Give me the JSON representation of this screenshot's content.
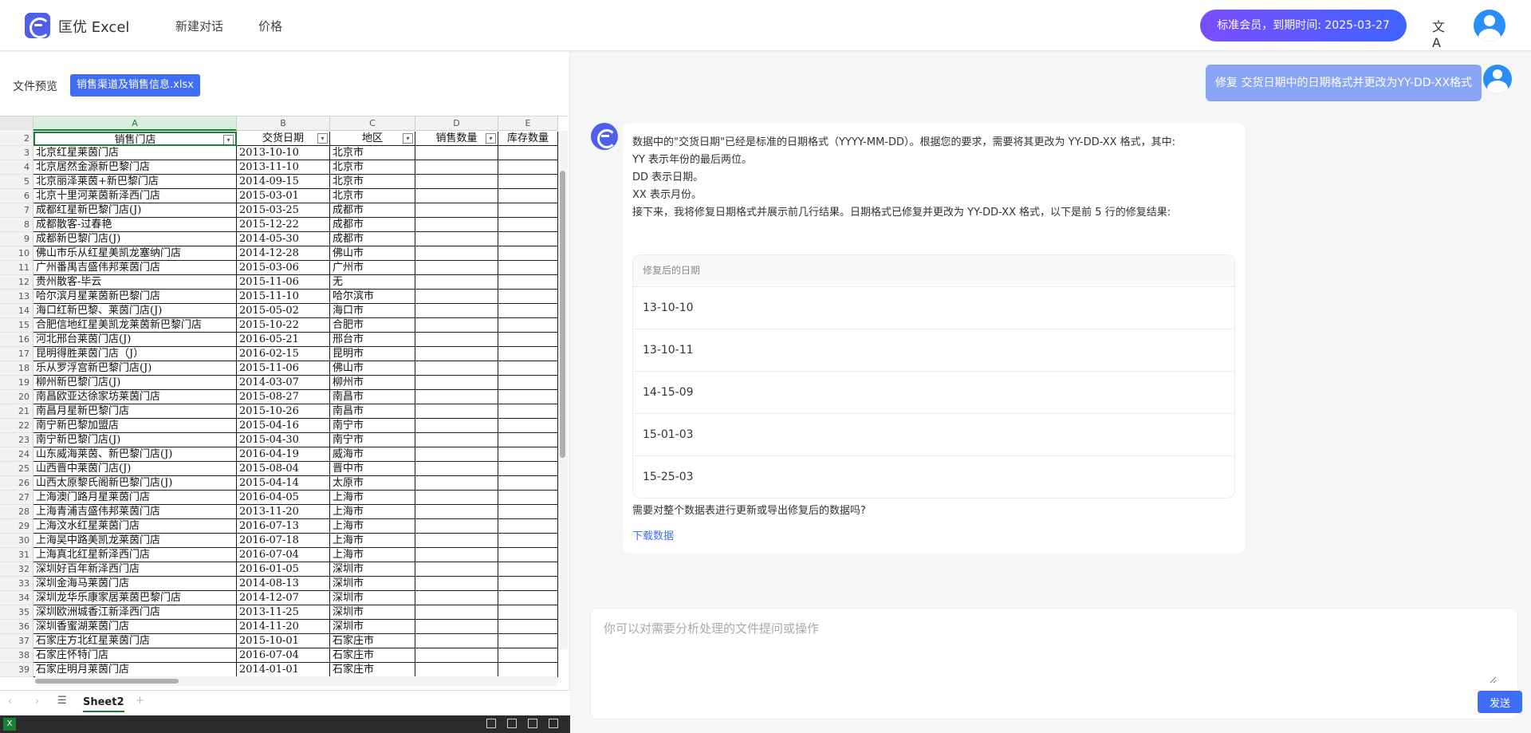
{
  "header": {
    "app_name": "匡优 Excel",
    "nav": [
      "新建对话",
      "价格"
    ],
    "membership": "标准会员，到期时间: 2025-03-27",
    "translate_icon": "文A"
  },
  "left": {
    "file_preview_label": "文件预览",
    "file_name": "销售渠道及销售信息.xlsx",
    "columns": [
      "A",
      "B",
      "C",
      "D",
      "E"
    ],
    "header_row_num": "2",
    "header_cells": [
      "销售门店",
      "交货日期",
      "地区",
      "销售数量",
      "库存数量"
    ],
    "rows": [
      [
        "3",
        "北京红星莱茵门店",
        "2013-10-10",
        "北京市"
      ],
      [
        "4",
        "北京居然金源新巴黎门店",
        "2013-11-10",
        "北京市"
      ],
      [
        "5",
        "北京丽泽莱茵+新巴黎门店",
        "2014-09-15",
        "北京市"
      ],
      [
        "6",
        "北京十里河莱茵新泽西门店",
        "2015-03-01",
        "北京市"
      ],
      [
        "7",
        "成都红星新巴黎门店(J)",
        "2015-03-25",
        "成都市"
      ],
      [
        "8",
        "成都散客-过春艳",
        "2015-12-22",
        "成都市"
      ],
      [
        "9",
        "成都新巴黎门店(J)",
        "2014-05-30",
        "成都市"
      ],
      [
        "10",
        "佛山市乐从红星美凯龙塞纳门店",
        "2014-12-28",
        "佛山市"
      ],
      [
        "11",
        "广州番禺吉盛伟邦莱茵门店",
        "2015-03-06",
        "广州市"
      ],
      [
        "12",
        "贵州散客-毕云",
        "2015-11-06",
        "无"
      ],
      [
        "13",
        "哈尔滨月星莱茵新巴黎门店",
        "2015-11-10",
        "哈尔滨市"
      ],
      [
        "14",
        "海口红新巴黎、莱茵门店(J)",
        "2015-05-02",
        "海口市"
      ],
      [
        "15",
        "合肥信地红星美凯龙莱茵新巴黎门店",
        "2015-10-22",
        "合肥市"
      ],
      [
        "16",
        "河北邢台莱茵门店(J)",
        "2016-05-21",
        "邢台市"
      ],
      [
        "17",
        "昆明得胜莱茵门店（J）",
        "2016-02-15",
        "昆明市"
      ],
      [
        "18",
        "乐从罗浮宫新巴黎门店(J)",
        "2015-11-06",
        "佛山市"
      ],
      [
        "19",
        "柳州新巴黎门店(J)",
        "2014-03-07",
        "柳州市"
      ],
      [
        "20",
        "南昌欧亚达徐家坊莱茵门店",
        "2015-08-27",
        "南昌市"
      ],
      [
        "21",
        "南昌月星新巴黎门店",
        "2015-10-26",
        "南昌市"
      ],
      [
        "22",
        "南宁新巴黎加盟店",
        "2015-04-16",
        "南宁市"
      ],
      [
        "23",
        "南宁新巴黎门店(J)",
        "2015-04-30",
        "南宁市"
      ],
      [
        "24",
        "山东威海莱茵、新巴黎门店(J)",
        "2016-04-19",
        "威海市"
      ],
      [
        "25",
        "山西晋中莱茵门店(J)",
        "2015-08-04",
        "晋中市"
      ],
      [
        "26",
        "山西太原黎氏阁新巴黎门店(J)",
        "2015-04-14",
        "太原市"
      ],
      [
        "27",
        "上海澳门路月星莱茵门店",
        "2016-04-05",
        "上海市"
      ],
      [
        "28",
        "上海青浦吉盛伟邦莱茵门店",
        "2013-11-20",
        "上海市"
      ],
      [
        "29",
        "上海汶水红星莱茵门店",
        "2016-07-13",
        "上海市"
      ],
      [
        "30",
        "上海吴中路美凯龙莱茵门店",
        "2016-07-18",
        "上海市"
      ],
      [
        "31",
        "上海真北红星新泽西门店",
        "2016-07-04",
        "上海市"
      ],
      [
        "32",
        "深圳好百年新泽西门店",
        "2016-01-05",
        "深圳市"
      ],
      [
        "33",
        "深圳金海马莱茵门店",
        "2014-08-13",
        "深圳市"
      ],
      [
        "34",
        "深圳龙华乐康家居莱茵巴黎门店",
        "2014-12-07",
        "深圳市"
      ],
      [
        "35",
        "深圳欧洲城香江新泽西门店",
        "2013-11-25",
        "深圳市"
      ],
      [
        "36",
        "深圳香蜜湖莱茵门店",
        "2014-11-20",
        "深圳市"
      ],
      [
        "37",
        "石家庄方北红星莱茵门店",
        "2015-10-01",
        "石家庄市"
      ],
      [
        "38",
        "石家庄怀特门店",
        "2016-07-04",
        "石家庄市"
      ],
      [
        "39",
        "石家庄明月莱茵门店",
        "2014-01-01",
        "石家庄市"
      ]
    ],
    "sheet_tab": "Sheet2"
  },
  "chat": {
    "user_message": "修复 交货日期中的日期格式并更改为YY-DD-XX格式",
    "bot_lines": [
      "数据中的\"交货日期\"已经是标准的日期格式（YYYY-MM-DD）。根据您的要求，需要将其更改为 YY-DD-XX 格式，其中:",
      "YY 表示年份的最后两位。",
      "DD 表示日期。",
      "XX 表示月份。",
      "接下来，我将修复日期格式并展示前几行结果。日期格式已修复并更改为 YY-DD-XX 格式，以下是前 5 行的修复结果:"
    ],
    "table_header": "修复后的日期",
    "table_rows": [
      "13-10-10",
      "13-10-11",
      "14-15-09",
      "15-01-03",
      "15-25-03"
    ],
    "followup": "需要对整个数据表进行更新或导出修复后的数据吗?",
    "download_link": "下载数据",
    "input_placeholder": "你可以对需要分析处理的文件提问或操作",
    "send_label": "发送"
  }
}
